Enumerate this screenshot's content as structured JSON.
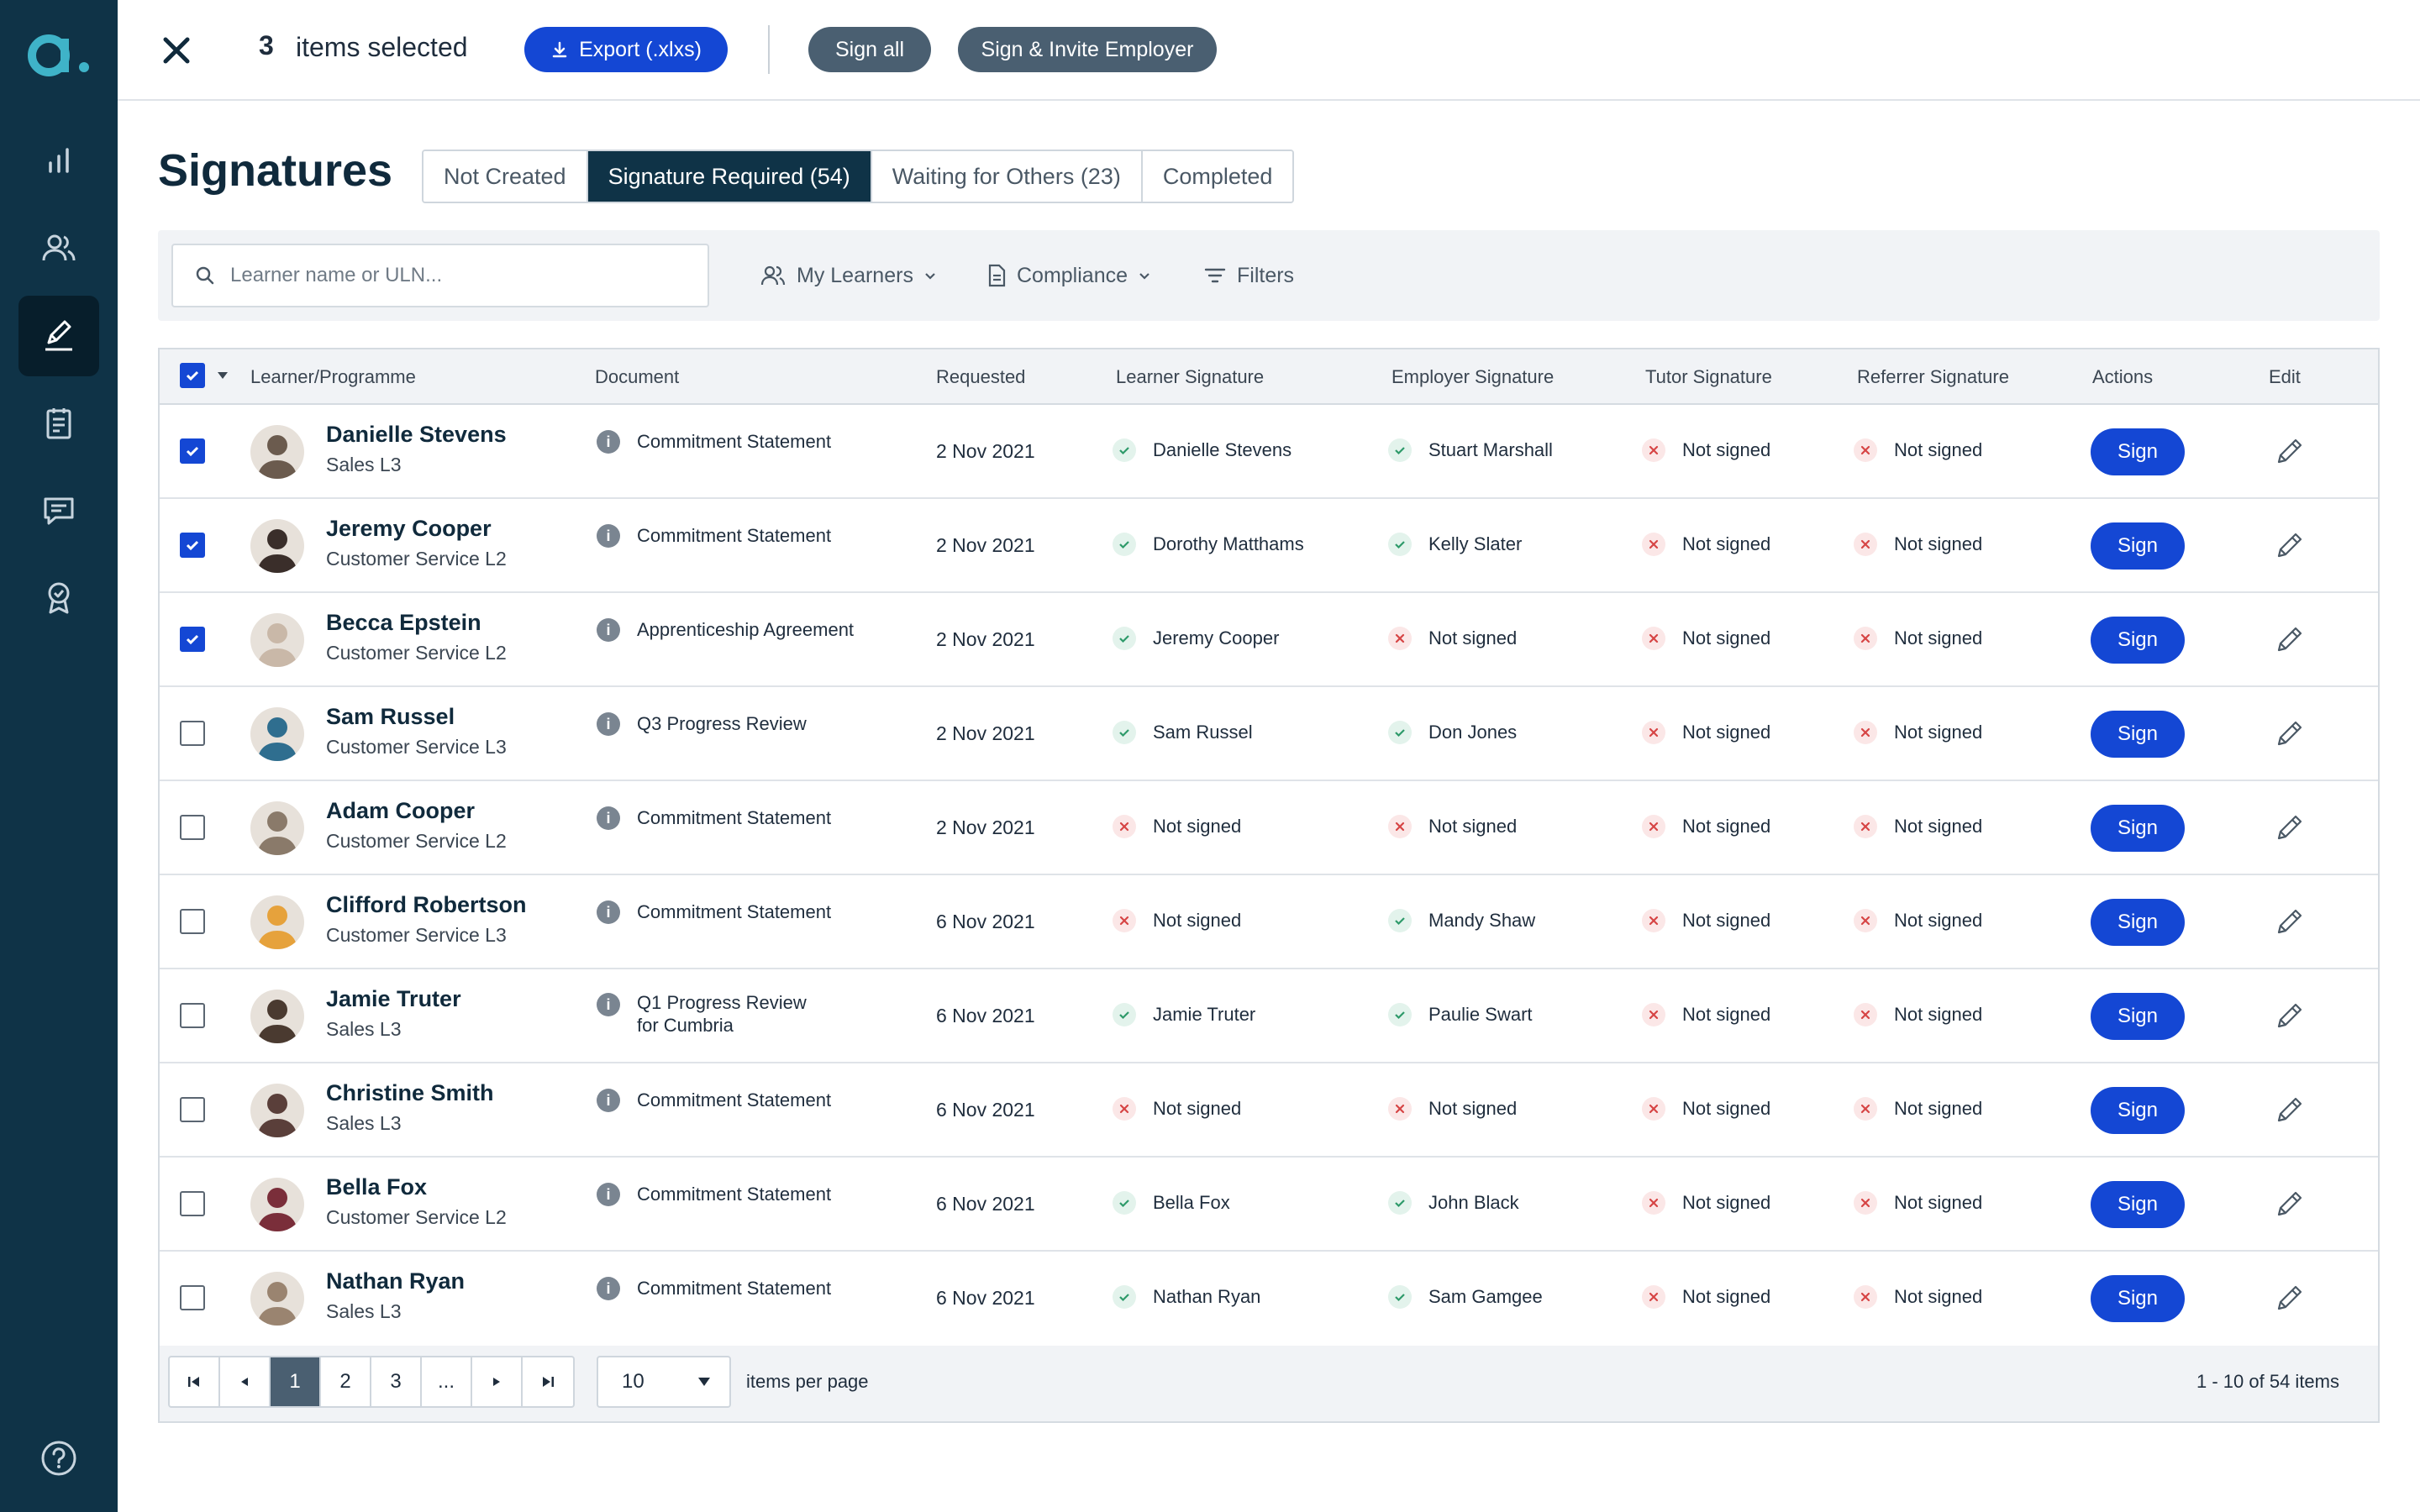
{
  "app": {
    "logo_text": "a.",
    "brand_color": "#0f3347",
    "accent_color": "#1447d4"
  },
  "sidebar": {
    "items": [
      {
        "icon": "bar-chart-icon",
        "active": false
      },
      {
        "icon": "users-icon",
        "active": false
      },
      {
        "icon": "signature-pen-icon",
        "active": true
      },
      {
        "icon": "clipboard-icon",
        "active": false
      },
      {
        "icon": "chat-icon",
        "active": false
      },
      {
        "icon": "award-icon",
        "active": false
      }
    ],
    "help_icon": "help-icon"
  },
  "topbar": {
    "selected_count": "3",
    "selected_text": "items selected",
    "export_label": "Export (.xlxs)",
    "sign_all_label": "Sign all",
    "sign_invite_label": "Sign & Invite Employer"
  },
  "page": {
    "title": "Signatures",
    "tabs": [
      {
        "label": "Not Created",
        "active": false
      },
      {
        "label": "Signature Required (54)",
        "active": true
      },
      {
        "label": "Waiting for Others (23)",
        "active": false
      },
      {
        "label": "Completed",
        "active": false
      }
    ]
  },
  "filters": {
    "search_placeholder": "Learner name or ULN...",
    "my_learners": "My Learners",
    "compliance": "Compliance",
    "filters": "Filters"
  },
  "table": {
    "columns": {
      "learner": "Learner/Programme",
      "document": "Document",
      "requested": "Requested",
      "learner_sig": "Learner Signature",
      "employer_sig": "Employer Signature",
      "tutor_sig": "Tutor Signature",
      "referrer_sig": "Referrer Signature",
      "actions": "Actions",
      "edit": "Edit"
    },
    "sign_label": "Sign",
    "rows": [
      {
        "checked": true,
        "name": "Danielle Stevens",
        "programme": "Sales L3",
        "doc1": "Commitment Statement",
        "doc2": "",
        "requested": "2 Nov 2021",
        "learner_sig": "Danielle Stevens",
        "learner_ok": true,
        "employer_sig": "Stuart Marshall",
        "employer_ok": true,
        "tutor_sig": "Not signed",
        "referrer_sig": "Not signed"
      },
      {
        "checked": true,
        "name": "Jeremy Cooper",
        "programme": "Customer Service L2",
        "doc1": "Commitment Statement",
        "doc2": "",
        "requested": "2 Nov 2021",
        "learner_sig": "Dorothy Matthams",
        "learner_ok": true,
        "employer_sig": "Kelly Slater",
        "employer_ok": true,
        "tutor_sig": "Not signed",
        "referrer_sig": "Not signed"
      },
      {
        "checked": true,
        "name": "Becca Epstein",
        "programme": "Customer Service L2",
        "doc1": "Apprenticeship Agreement",
        "doc2": "",
        "requested": "2 Nov 2021",
        "learner_sig": "Jeremy Cooper",
        "learner_ok": true,
        "employer_sig": "Not signed",
        "employer_ok": false,
        "tutor_sig": "Not signed",
        "referrer_sig": "Not signed"
      },
      {
        "checked": false,
        "name": "Sam Russel",
        "programme": "Customer Service L3",
        "doc1": "Q3 Progress Review",
        "doc2": "",
        "requested": "2 Nov 2021",
        "learner_sig": "Sam Russel",
        "learner_ok": true,
        "employer_sig": "Don Jones",
        "employer_ok": true,
        "tutor_sig": "Not signed",
        "referrer_sig": "Not signed"
      },
      {
        "checked": false,
        "name": "Adam Cooper",
        "programme": "Customer Service L2",
        "doc1": "Commitment Statement",
        "doc2": "",
        "requested": "2 Nov 2021",
        "learner_sig": "Not signed",
        "learner_ok": false,
        "employer_sig": "Not signed",
        "employer_ok": false,
        "tutor_sig": "Not signed",
        "referrer_sig": "Not signed"
      },
      {
        "checked": false,
        "name": "Clifford Robertson",
        "programme": "Customer Service L3",
        "doc1": "Commitment Statement",
        "doc2": "",
        "requested": "6 Nov 2021",
        "learner_sig": "Not signed",
        "learner_ok": false,
        "employer_sig": "Mandy Shaw",
        "employer_ok": true,
        "tutor_sig": "Not signed",
        "referrer_sig": "Not signed"
      },
      {
        "checked": false,
        "name": "Jamie Truter",
        "programme": "Sales L3",
        "doc1": "Q1 Progress Review",
        "doc2": "for Cumbria",
        "requested": "6 Nov 2021",
        "learner_sig": "Jamie Truter",
        "learner_ok": true,
        "employer_sig": "Paulie Swart",
        "employer_ok": true,
        "tutor_sig": "Not signed",
        "referrer_sig": "Not signed"
      },
      {
        "checked": false,
        "name": "Christine Smith",
        "programme": "Sales L3",
        "doc1": "Commitment Statement",
        "doc2": "",
        "requested": "6 Nov 2021",
        "learner_sig": "Not signed",
        "learner_ok": false,
        "employer_sig": "Not signed",
        "employer_ok": false,
        "tutor_sig": "Not signed",
        "referrer_sig": "Not signed"
      },
      {
        "checked": false,
        "name": "Bella Fox",
        "programme": "Customer Service L2",
        "doc1": "Commitment Statement",
        "doc2": "",
        "requested": "6 Nov 2021",
        "learner_sig": "Bella Fox",
        "learner_ok": true,
        "employer_sig": "John Black",
        "employer_ok": true,
        "tutor_sig": "Not signed",
        "referrer_sig": "Not signed"
      },
      {
        "checked": false,
        "name": "Nathan Ryan",
        "programme": "Sales L3",
        "doc1": "Commitment Statement",
        "doc2": "",
        "requested": "6 Nov 2021",
        "learner_sig": "Nathan Ryan",
        "learner_ok": true,
        "employer_sig": "Sam Gamgee",
        "employer_ok": true,
        "tutor_sig": "Not signed",
        "referrer_sig": "Not signed"
      }
    ]
  },
  "pager": {
    "pages": [
      "1",
      "2",
      "3",
      "..."
    ],
    "per_page": "10",
    "per_page_label": "items per page",
    "summary": "1 - 10 of 54 items"
  }
}
